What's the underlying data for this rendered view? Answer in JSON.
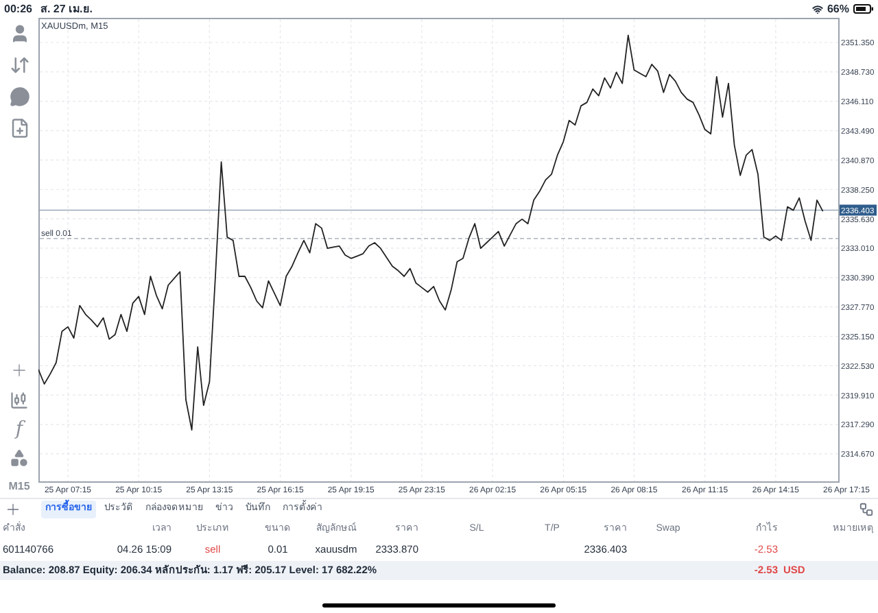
{
  "status_bar": {
    "time": "00:26",
    "date": "ส. 27 เม.ย.",
    "battery": "66%"
  },
  "sidebar": {
    "indicator_label": "f",
    "timeframe": "M15"
  },
  "chart": {
    "symbol": "XAUUSDm, M15",
    "chart_data": {
      "type": "line",
      "ylim": [
        2312.22,
        2353.55
      ],
      "categories": [
        null,
        null,
        null,
        null,
        null,
        "25 Apr 07:15",
        null,
        null,
        null,
        null,
        null,
        null,
        null,
        null,
        null,
        null,
        null,
        "25 Apr 10:15",
        null,
        null,
        null,
        null,
        null,
        null,
        null,
        null,
        null,
        null,
        null,
        "25 Apr 13:15",
        null,
        null,
        null,
        null,
        null,
        null,
        null,
        null,
        null,
        null,
        null,
        "25 Apr 16:15",
        null,
        null,
        null,
        null,
        null,
        null,
        null,
        null,
        null,
        null,
        null,
        "25 Apr 19:15",
        null,
        null,
        null,
        null,
        null,
        null,
        null,
        null,
        null,
        null,
        null,
        "25 Apr 23:15",
        null,
        null,
        null,
        null,
        null,
        null,
        null,
        null,
        null,
        null,
        null,
        "26 Apr 02:15",
        null,
        null,
        null,
        null,
        null,
        null,
        null,
        null,
        null,
        null,
        null,
        "26 Apr 05:15",
        null,
        null,
        null,
        null,
        null,
        null,
        null,
        null,
        null,
        null,
        null,
        "26 Apr 08:15",
        null,
        null,
        null,
        null,
        null,
        null,
        null,
        null,
        null,
        null,
        null,
        "26 Apr 11:15",
        null,
        null,
        null,
        null,
        null,
        null,
        null,
        null,
        null,
        null,
        null,
        "26 Apr 14:15",
        null,
        null,
        null,
        null,
        null,
        null,
        null,
        null,
        null,
        null,
        null,
        "26 Apr 17:15"
      ],
      "yticks": [
        {
          "value": 2351.35,
          "label": "2351.350"
        },
        {
          "value": 2348.73,
          "label": "2348.730"
        },
        {
          "value": 2346.11,
          "label": "2346.110"
        },
        {
          "value": 2343.49,
          "label": "2343.490"
        },
        {
          "value": 2340.87,
          "label": "2340.870"
        },
        {
          "value": 2338.25,
          "label": "2338.250"
        },
        {
          "value": 2335.63,
          "label": "2335.630"
        },
        {
          "value": 2333.01,
          "label": "2333.010"
        },
        {
          "value": 2330.39,
          "label": "2330.390"
        },
        {
          "value": 2327.77,
          "label": "2327.770"
        },
        {
          "value": 2325.15,
          "label": "2325.150"
        },
        {
          "value": 2322.53,
          "label": "2322.530"
        },
        {
          "value": 2319.91,
          "label": "2319.910"
        },
        {
          "value": 2317.29,
          "label": "2317.290"
        },
        {
          "value": 2314.67,
          "label": "2314.670"
        }
      ],
      "series": [
        {
          "color": "#222222",
          "values": [
            2322.2,
            2320.9,
            2321.8,
            2322.8,
            2325.6,
            2326.0,
            2325.0,
            2327.9,
            2327.1,
            2326.6,
            2326.0,
            2326.8,
            2324.9,
            2325.3,
            2327.1,
            2325.6,
            2328.1,
            2328.7,
            2327.1,
            2330.5,
            2328.8,
            2327.6,
            2329.7,
            2330.3,
            2330.9,
            2319.5,
            2316.8,
            2324.2,
            2319.0,
            2321.1,
            2330.5,
            2340.7,
            2334.0,
            2333.7,
            2330.5,
            2330.5,
            2329.5,
            2328.3,
            2327.7,
            2330.1,
            2329.0,
            2327.9,
            2330.5,
            2331.4,
            2332.6,
            2333.7,
            2332.6,
            2335.2,
            2334.8,
            2333.0,
            2333.1,
            2333.2,
            2332.4,
            2332.1,
            2332.3,
            2332.5,
            2333.2,
            2333.5,
            2333.0,
            2332.2,
            2331.4,
            2331.0,
            2330.5,
            2331.2,
            2329.9,
            2329.5,
            2329.1,
            2329.6,
            2328.3,
            2327.5,
            2329.3,
            2331.8,
            2332.1,
            2333.9,
            2335.2,
            2333.0,
            2333.5,
            2334.0,
            2334.5,
            2333.2,
            2334.2,
            2335.2,
            2335.6,
            2335.2,
            2337.3,
            2338.1,
            2339.1,
            2339.6,
            2341.3,
            2342.5,
            2344.4,
            2344.0,
            2345.7,
            2346.0,
            2347.2,
            2346.6,
            2348.2,
            2347.3,
            2348.7,
            2347.7,
            2352.0,
            2348.9,
            2348.6,
            2348.3,
            2349.4,
            2348.8,
            2346.9,
            2348.5,
            2347.9,
            2346.9,
            2346.3,
            2346.0,
            2344.9,
            2343.6,
            2343.2,
            2348.3,
            2344.7,
            2347.7,
            2342.2,
            2339.5,
            2341.3,
            2341.8,
            2339.6,
            2334.0,
            2333.7,
            2334.1,
            2333.7,
            2336.7,
            2336.4,
            2337.5,
            2335.4,
            2333.7,
            2337.3,
            2336.3,
            null,
            null,
            null,
            null
          ]
        }
      ],
      "grid": true,
      "ref_lines": [
        {
          "axis": "y",
          "value": 2336.403,
          "label": "2336.403"
        },
        {
          "axis": "y",
          "value": 2333.87,
          "label": "sell 0.01"
        }
      ]
    }
  },
  "tabs": [
    {
      "label": "การซื้อขาย",
      "selected": true
    },
    {
      "label": "ประวัติ",
      "selected": false
    },
    {
      "label": "กล่องจดหมาย",
      "selected": false
    },
    {
      "label": "ข่าว",
      "selected": false
    },
    {
      "label": "บันทึก",
      "selected": false
    },
    {
      "label": "การตั้งค่า",
      "selected": false
    }
  ],
  "table": {
    "columns": [
      "คำสั่ง",
      "เวลา",
      "ประเภท",
      "ขนาด",
      "สัญลักษณ์",
      "ราคา",
      "S/L",
      "T/P",
      "ราคา",
      "Swap",
      "กำไร",
      "หมายเหตุ"
    ],
    "rows": [
      {
        "order": "601140766",
        "time": "04.26 15:09",
        "type": "sell",
        "size": "0.01",
        "symbol": "xauusdm",
        "open_price": "2333.870",
        "current_price": "2336.403",
        "profit": "-2.53"
      }
    ]
  },
  "summary": {
    "text": "Balance: 208.87 Equity: 206.34 หลักประกัน: 1.17 ฟรี: 205.17 Level: 17 682.22%",
    "profit": "-2.53",
    "currency": "USD"
  }
}
